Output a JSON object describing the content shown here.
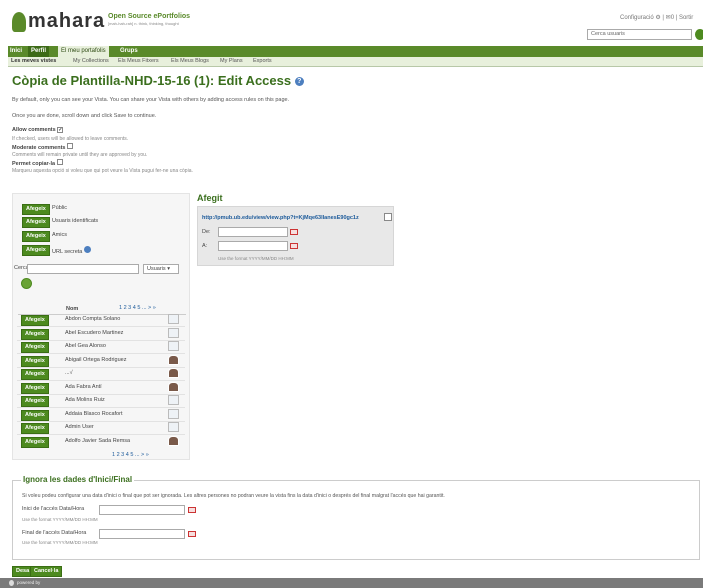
{
  "header": {
    "logo": "mahara",
    "tagline": "Open Source ePortfolios",
    "tagline_sub": "[mah-hah-rah] n. think, thinking, thought",
    "links": [
      "Configuració",
      "|",
      "0",
      "|",
      "Sortir"
    ],
    "search_placeholder": "Cerca usuaris"
  },
  "nav": {
    "main": [
      "Inici",
      "Perfil",
      "El meu portafolis",
      "Grups"
    ],
    "sub": [
      "Les meves vistes",
      "My Collections",
      "Els Meus Fitxers",
      "Els Meus Blogs",
      "My Plans",
      "Exports"
    ]
  },
  "page": {
    "title": "Còpia de Plantilla-NHD-15-16 (1): Edit Access",
    "intro1": "By default, only you can see your Vista. You can share your Vista with others by adding access rules on this page.",
    "intro2": "Once you are done, scroll down and click Save to continue.",
    "allow_comments": "Allow comments",
    "allow_comments_help": "If checked, users will be allowed to leave comments.",
    "moderate_comments": "Moderate comments",
    "moderate_comments_help": "Comments will remain private until they are approved by you.",
    "permit_copy": "Permet copiar-la",
    "permit_copy_help": "Marqueu aquesta opció si voleu que qui pot veure la Vista pugui fer-ne una còpia."
  },
  "share": {
    "add_label": "Afegeix",
    "options": [
      "Públic",
      "Usuaris identificats",
      "Amics",
      "URL secreta"
    ],
    "search_label": "Cerca",
    "search_type": "Usuaris",
    "col_name": "Nom",
    "pager_top": "1 2 3 4 5 ... > »",
    "pager_bottom": "1 2 3 4 5 ... > »",
    "users": [
      {
        "name": "Abdon Compta Solano",
        "icon": "default"
      },
      {
        "name": "Abel Escudero Martinez",
        "icon": "default"
      },
      {
        "name": "Abel Gea Alonso",
        "icon": "default"
      },
      {
        "name": "Abigail Ortega Rodriguez",
        "icon": "photo"
      },
      {
        "name": "...√",
        "icon": "photo"
      },
      {
        "name": "Ada Fabra Antí",
        "icon": "photo"
      },
      {
        "name": "Ada Molins Ruiz",
        "icon": "default"
      },
      {
        "name": "Addaia Blasco Rocafort",
        "icon": "default"
      },
      {
        "name": "Admin User",
        "icon": "default"
      },
      {
        "name": "Adolfo Javier Sada Remsa",
        "icon": "photo"
      }
    ]
  },
  "added": {
    "title": "Afegit",
    "url": "http://pmub.ub.edu/view/view.php?t=KjMqe63IIanesE90gc1z",
    "from_label": "De:",
    "to_label": "A:",
    "format_hint": "Use the format YYYY/MM/DD HH:MM"
  },
  "override": {
    "legend": "Ignora les dades d'Inici/Final",
    "desc": "Si voleu podeu configurar una data d'inici o final que pot ser ignorada. Les altres persones no podran veure la vista fins la data d'inici o després del final malgrat l'accés que hai garantit.",
    "start_label": "Inici de l'accés Data/Hora",
    "end_label": "Final de l'accés Data/Hora",
    "format_hint": "Use the format YYYY/MM/DD HH:MM"
  },
  "actions": {
    "save": "Desa",
    "cancel": "Cancel·la"
  },
  "footer": {
    "powered": "powered by"
  },
  "colors": {
    "accent": "#4d8a1f",
    "title": "#3b6f1e",
    "link": "#1c5a9a"
  }
}
